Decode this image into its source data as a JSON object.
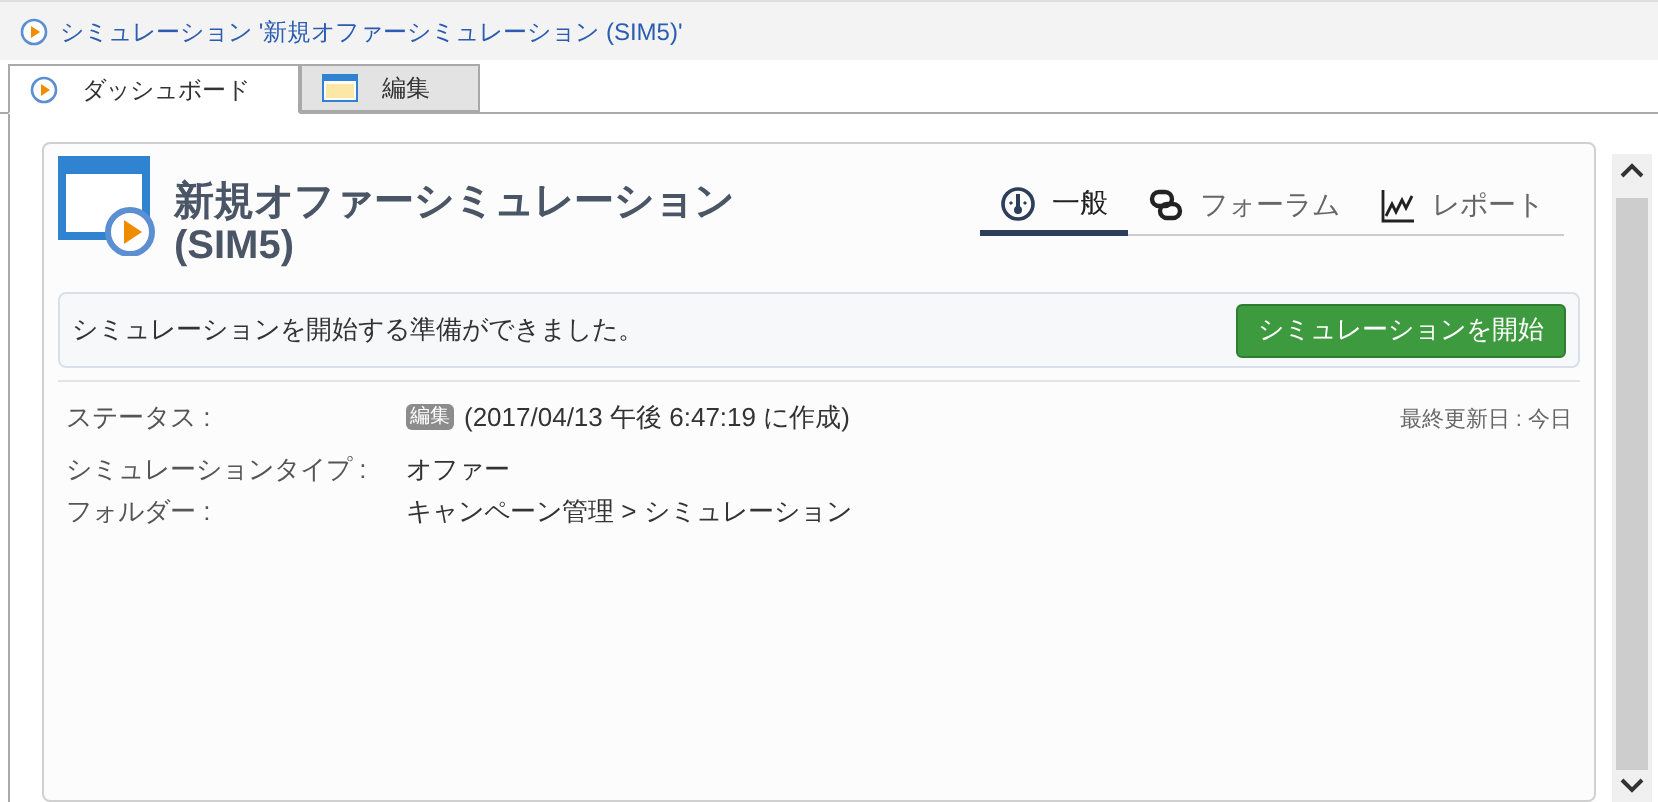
{
  "breadcrumb": "シミュレーション '新規オファーシミュレーション (SIM5)'",
  "tabs": [
    {
      "label": "ダッシュボード",
      "kind": "play",
      "selected": true
    },
    {
      "label": "編集",
      "kind": "window",
      "selected": false
    }
  ],
  "header": {
    "title": "新規オファーシミュレーション",
    "subtitle": "(SIM5)"
  },
  "view_tabs": [
    {
      "label": "一般",
      "kind": "gauge",
      "selected": true
    },
    {
      "label": "フォーラム",
      "kind": "chat",
      "selected": false
    },
    {
      "label": "レポート",
      "kind": "chart",
      "selected": false
    }
  ],
  "notice": {
    "message": "シミュレーションを開始する準備ができました。",
    "button": "シミュレーションを開始"
  },
  "details": [
    {
      "label": "ステータス :",
      "badge": "編集",
      "value": "(2017/04/13 午後 6:47:19 に作成)"
    },
    {
      "label": "シミュレーションタイプ :",
      "value": "オファー"
    },
    {
      "label": "フォルダー :",
      "value": "キャンペーン管理 > シミュレーション"
    }
  ],
  "last_updated": "最終更新日 : 今日"
}
